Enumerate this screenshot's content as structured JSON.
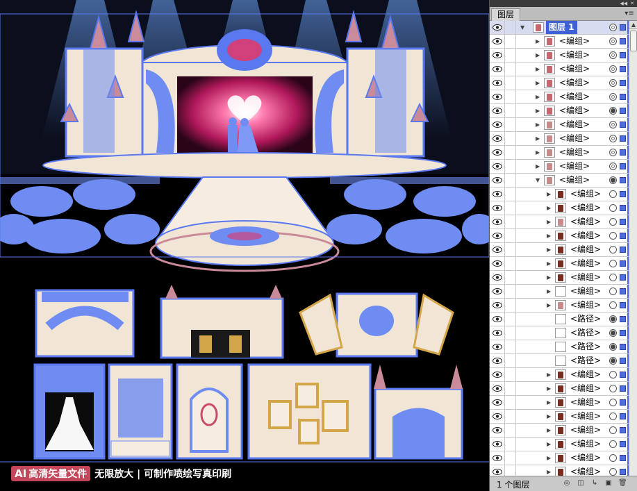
{
  "watermark": {
    "badge_ai": "AI",
    "badge_text": "高清矢量文件",
    "text": "无限放大 | 可制作喷绘写真印刷"
  },
  "panel": {
    "tab_label": "图层",
    "top_layer": "图层 1",
    "layer_count": "1 个图层",
    "rows": [
      {
        "label": "<编组>",
        "indent": 1,
        "expander": "closed",
        "thumb": "#c9656f",
        "target": "ring"
      },
      {
        "label": "<编组>",
        "indent": 1,
        "expander": "closed",
        "thumb": "#c9656f",
        "target": "ring"
      },
      {
        "label": "<编组>",
        "indent": 1,
        "expander": "closed",
        "thumb": "#c9656f",
        "target": "ring"
      },
      {
        "label": "<编组>",
        "indent": 1,
        "expander": "closed",
        "thumb": "#c9656f",
        "target": "ring"
      },
      {
        "label": "<编组>",
        "indent": 1,
        "expander": "closed",
        "thumb": "#c9656f",
        "target": "ring"
      },
      {
        "label": "<编组>",
        "indent": 1,
        "expander": "closed",
        "thumb": "#c9656f",
        "target": "filled"
      },
      {
        "label": "<编组>",
        "indent": 1,
        "expander": "closed",
        "thumb": "#c98a8a",
        "target": "ring"
      },
      {
        "label": "<编组>",
        "indent": 1,
        "expander": "closed",
        "thumb": "#c98a8a",
        "target": "ring"
      },
      {
        "label": "<编组>",
        "indent": 1,
        "expander": "closed",
        "thumb": "#c98a8a",
        "target": "ring"
      },
      {
        "label": "<编组>",
        "indent": 1,
        "expander": "closed",
        "thumb": "#c98a8a",
        "target": "ring"
      },
      {
        "label": "<编组>",
        "indent": 1,
        "expander": "open",
        "thumb": "#c98a8a",
        "target": "filled"
      },
      {
        "label": "<编组>",
        "indent": 2,
        "expander": "closed",
        "thumb": "#7a2b22",
        "target": "empty"
      },
      {
        "label": "<编组>",
        "indent": 2,
        "expander": "closed",
        "thumb": "#7a2b22",
        "target": "empty"
      },
      {
        "label": "<编组>",
        "indent": 2,
        "expander": "closed",
        "thumb": "#c98a8a",
        "target": "empty"
      },
      {
        "label": "<编组>",
        "indent": 2,
        "expander": "closed",
        "thumb": "#7a2b22",
        "target": "empty"
      },
      {
        "label": "<编组>",
        "indent": 2,
        "expander": "closed",
        "thumb": "#7a2b22",
        "target": "empty"
      },
      {
        "label": "<编组>",
        "indent": 2,
        "expander": "closed",
        "thumb": "#7a2b22",
        "target": "empty"
      },
      {
        "label": "<编组>",
        "indent": 2,
        "expander": "closed",
        "thumb": "#7a2b22",
        "target": "empty"
      },
      {
        "label": "<编组>",
        "indent": 2,
        "expander": "closed",
        "thumb": "#ffffff",
        "target": "empty"
      },
      {
        "label": "<编组>",
        "indent": 2,
        "expander": "closed",
        "thumb": "#c98a8a",
        "target": "empty"
      },
      {
        "label": "<路径>",
        "indent": 2,
        "expander": "none",
        "thumb": "#ffffff",
        "target": "filled"
      },
      {
        "label": "<路径>",
        "indent": 2,
        "expander": "none",
        "thumb": "#ffffff",
        "target": "filled"
      },
      {
        "label": "<路径>",
        "indent": 2,
        "expander": "none",
        "thumb": "#ffffff",
        "target": "filled"
      },
      {
        "label": "<路径>",
        "indent": 2,
        "expander": "none",
        "thumb": "#ffffff",
        "target": "filled"
      },
      {
        "label": "<编组>",
        "indent": 2,
        "expander": "closed",
        "thumb": "#7a2b22",
        "target": "empty"
      },
      {
        "label": "<编组>",
        "indent": 2,
        "expander": "closed",
        "thumb": "#7a2b22",
        "target": "empty"
      },
      {
        "label": "<编组>",
        "indent": 2,
        "expander": "closed",
        "thumb": "#7a2b22",
        "target": "empty"
      },
      {
        "label": "<编组>",
        "indent": 2,
        "expander": "closed",
        "thumb": "#7a2b22",
        "target": "empty"
      },
      {
        "label": "<编组>",
        "indent": 2,
        "expander": "closed",
        "thumb": "#7a2b22",
        "target": "empty"
      },
      {
        "label": "<编组>",
        "indent": 2,
        "expander": "closed",
        "thumb": "#7a2b22",
        "target": "empty"
      },
      {
        "label": "<编组>",
        "indent": 2,
        "expander": "closed",
        "thumb": "#7a2b22",
        "target": "empty"
      },
      {
        "label": "<编组>",
        "indent": 2,
        "expander": "closed",
        "thumb": "#7a2b22",
        "target": "empty"
      }
    ]
  },
  "colors": {
    "selection_blue": "#5a78f0",
    "stage_pink": "#d0407a",
    "cream": "#f1e6d6",
    "panel_bg": "#d6d6d6"
  }
}
